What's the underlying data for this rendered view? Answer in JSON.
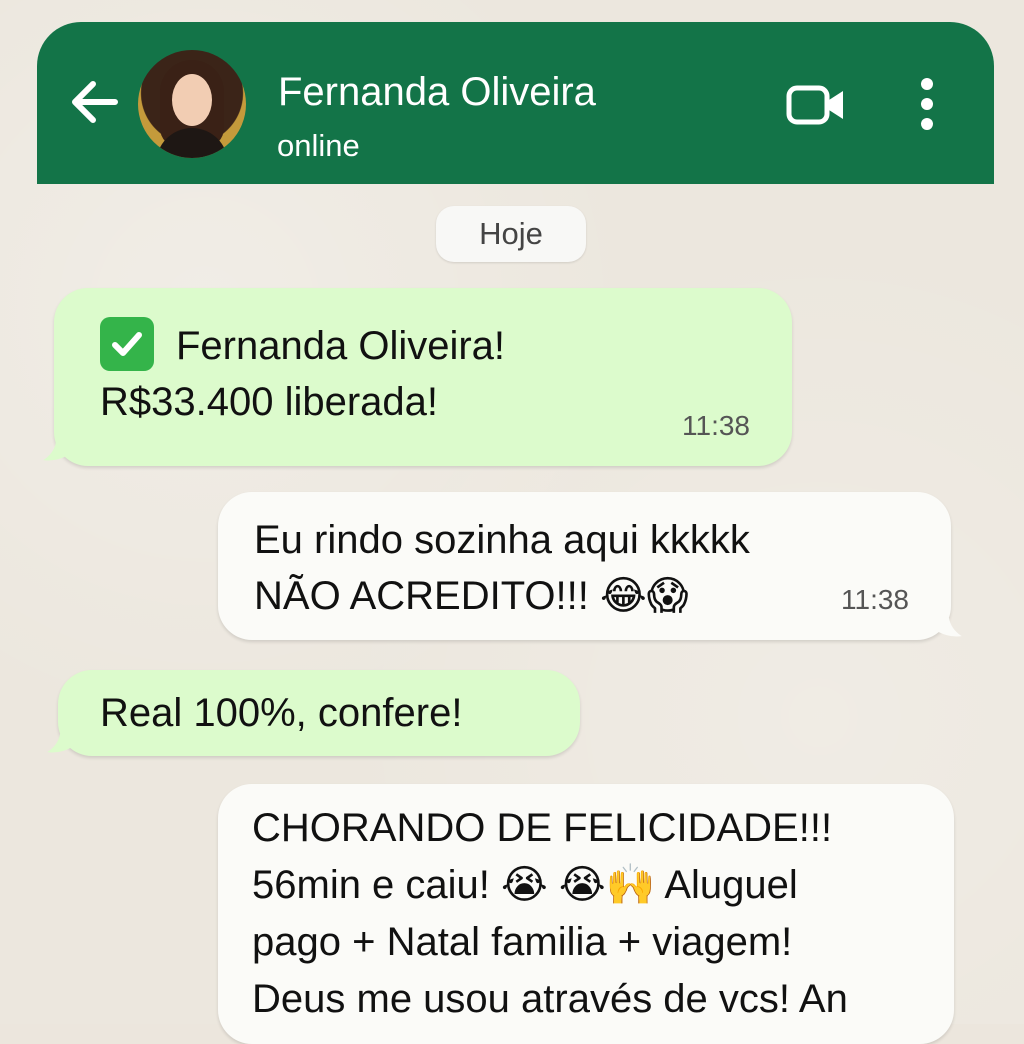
{
  "header": {
    "contact_name": "Fernanda Oliveira",
    "status": "online"
  },
  "date_chip": "Hoje",
  "messages": [
    {
      "direction": "incoming",
      "line1": "Fernanda Oliveira!",
      "line2": "R$33.400 liberada!",
      "time": "11:38"
    },
    {
      "direction": "outgoing",
      "line1": "Eu rindo sozinha aqui kkkkk",
      "line2": "NÃO ACREDITO!!! 😂😱",
      "time": "11:38"
    },
    {
      "direction": "incoming",
      "line1": "Real 100%, confere!"
    },
    {
      "direction": "outgoing",
      "lines": [
        "CHORANDO DE FELICIDADE!!!",
        "56min e caiu! 😭 😭🙌 Aluguel",
        "pago + Natal familia + viagem!",
        "Deus me usou através de vcs! An"
      ]
    }
  ],
  "colors": {
    "header": "#137448",
    "incoming_bubble": "#dcfbcc",
    "outgoing_bubble": "#fbfbf8",
    "background": "#ece6dd",
    "check": "#34b44a"
  },
  "icons": [
    "arrow-left-icon",
    "video-call-icon",
    "more-vertical-icon",
    "check-icon"
  ]
}
